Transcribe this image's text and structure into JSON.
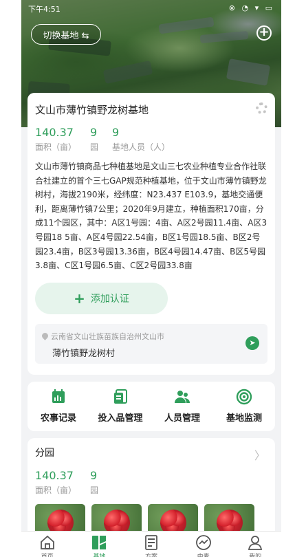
{
  "status_bar": {
    "time": "下午4:51",
    "right": "⊗ ◔ ▾ ▭"
  },
  "hero": {
    "switch_label": "切换基地 ⇆",
    "plus_label": "+"
  },
  "base": {
    "title": "文山市薄竹镇野龙树基地",
    "stats": [
      {
        "value": "140.37",
        "label": "面积（亩）"
      },
      {
        "value": "9",
        "label": "园"
      },
      {
        "value": "9",
        "label": "基地人员（人）"
      }
    ],
    "description": "文山市薄竹镇商品七种植基地是文山三七农业种植专业合作社联合社建立的首个三七GAP规范种植基地，位于文山市薄竹镇野龙树村，海拔2190米，经纬度：N23.437 E103.9，基地交通便利，距离薄竹镇7公里；2020年9月建立，种植面积170亩，分成11个园区，其中：A区1号园：4亩、A区2号园11.4亩、A区3号园18 5亩、A区4号园22.54亩，B区1号园18.5亩、B区2号园23.4亩，B区3号园13.36亩，B区4号园14.47亩、B区5号园3.8亩、C区1号园6.5亩、C区2号园33.8亩",
    "cert_button": "添加认证",
    "address_line1": "云南省文山壮族苗族自治州文山市",
    "address_line2": "薄竹镇野龙树村"
  },
  "actions": [
    {
      "label": "农事记录",
      "icon": "chart-calendar-icon"
    },
    {
      "label": "投入品管理",
      "icon": "document-list-icon"
    },
    {
      "label": "人员管理",
      "icon": "people-icon"
    },
    {
      "label": "基地监测",
      "icon": "target-icon"
    }
  ],
  "sub_garden": {
    "title": "分园",
    "stats": [
      {
        "value": "140.37",
        "label": "面积（亩）"
      },
      {
        "value": "9",
        "label": "园"
      }
    ]
  },
  "tabs": [
    {
      "label": "首页",
      "icon": "home-icon"
    },
    {
      "label": "基地",
      "icon": "base-grid-icon"
    },
    {
      "label": "方案",
      "icon": "plan-doc-icon"
    },
    {
      "label": "由麦",
      "icon": "trend-icon"
    },
    {
      "label": "我的",
      "icon": "user-icon"
    }
  ],
  "colors": {
    "accent": "#2f9e5b",
    "accent_light": "#e6f4ec",
    "background": "#f2f3f5"
  }
}
